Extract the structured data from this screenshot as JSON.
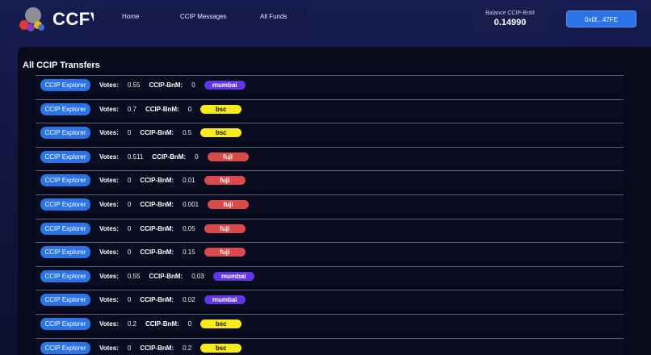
{
  "header": {
    "brand": "CCFV",
    "nav": [
      "Home",
      "CCIP Messages",
      "All Funds"
    ],
    "balance_label": "Balance CCIP-BnM",
    "balance_value": "0.14990",
    "wallet": "0x0f...47FE"
  },
  "main": {
    "title": "All CCIP Transfers",
    "explorer_label": "CCIP Explorer",
    "votes_label": "Votes:",
    "bnm_label": "CCIP-BnM:",
    "rows": [
      {
        "votes": "0.55",
        "bnm": "0",
        "chain": "mumbai"
      },
      {
        "votes": "0.7",
        "bnm": "0",
        "chain": "bsc"
      },
      {
        "votes": "0",
        "bnm": "0.5",
        "chain": "bsc"
      },
      {
        "votes": "0.511",
        "bnm": "0",
        "chain": "fuji"
      },
      {
        "votes": "0",
        "bnm": "0.01",
        "chain": "fuji"
      },
      {
        "votes": "0",
        "bnm": "0.001",
        "chain": "fuji"
      },
      {
        "votes": "0",
        "bnm": "0.05",
        "chain": "fuji"
      },
      {
        "votes": "0",
        "bnm": "0.15",
        "chain": "fuji"
      },
      {
        "votes": "0.55",
        "bnm": "0.03",
        "chain": "mumbai"
      },
      {
        "votes": "0",
        "bnm": "0.02",
        "chain": "mumbai"
      },
      {
        "votes": "0.2",
        "bnm": "0",
        "chain": "bsc"
      },
      {
        "votes": "0",
        "bnm": "0.2",
        "chain": "bsc"
      }
    ]
  },
  "colors": {
    "accent": "#2b74e8",
    "mumbai": "#6236e6",
    "bsc": "#f7ea1e",
    "fuji": "#db4a4a"
  }
}
